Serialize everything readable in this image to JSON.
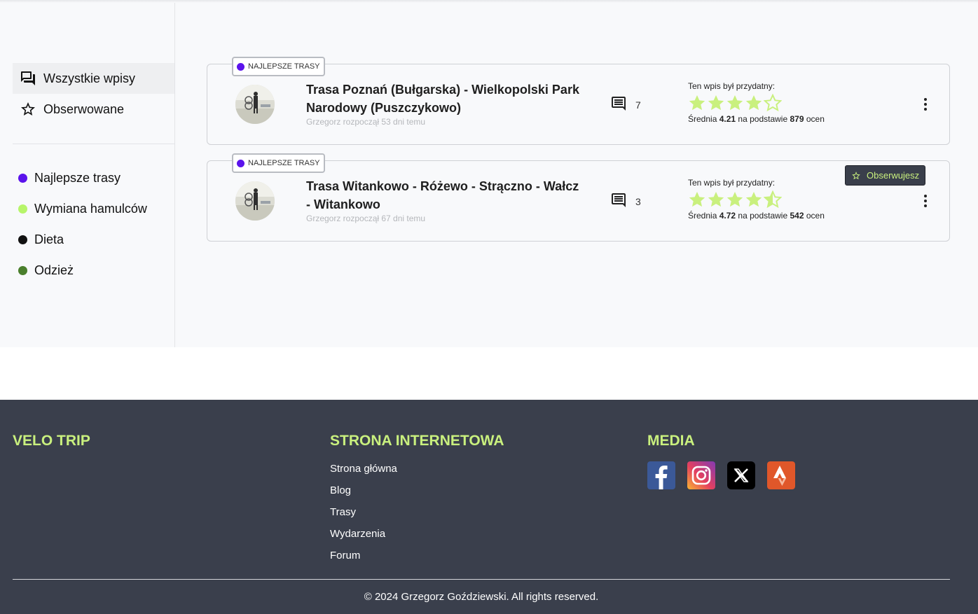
{
  "sidebar": {
    "nav": [
      {
        "label": "Wszystkie wpisy",
        "icon": "forum-icon",
        "active": true
      },
      {
        "label": "Obserwowane",
        "icon": "star-outline-icon",
        "active": false
      }
    ],
    "categories": [
      {
        "label": "Najlepsze trasy",
        "color": "#5b13ec"
      },
      {
        "label": "Wymiana hamulców",
        "color": "#b7f56a"
      },
      {
        "label": "Dieta",
        "color": "#111111"
      },
      {
        "label": "Odzież",
        "color": "#4a7f2c"
      }
    ]
  },
  "posts": [
    {
      "tag": "NAJLEPSZE TRASY",
      "tag_color": "#5b13ec",
      "title": "Trasa Poznań (Bułgarska) - Wielkopolski Park Narodowy (Puszczykowo)",
      "meta": "Grzegorz rozpoczął 53 dni temu",
      "comments": "7",
      "rating_label": "Ten wpis był przydatny:",
      "rating_value": 4.21,
      "avg_prefix": "Średnia",
      "avg": "4.21",
      "avg_middle": "na podstawie",
      "count": "879",
      "avg_suffix": "ocen",
      "following": false
    },
    {
      "tag": "NAJLEPSZE TRASY",
      "tag_color": "#5b13ec",
      "title": "Trasa Witankowo - Różewo - Strączno - Wałcz - Witankowo",
      "meta": "Grzegorz rozpoczął 67 dni temu",
      "comments": "3",
      "rating_label": "Ten wpis był przydatny:",
      "rating_value": 4.72,
      "avg_prefix": "Średnia",
      "avg": "4.72",
      "avg_middle": "na podstawie",
      "count": "542",
      "avg_suffix": "ocen",
      "following": true,
      "follow_label": "Obserwujesz"
    }
  ],
  "colors": {
    "accent": "#c9f07e",
    "star": "#c9f07e",
    "footer_bg": "#3a3f4c"
  },
  "footer": {
    "brand": "VELO TRIP",
    "website_heading": "STRONA INTERNETOWA",
    "links": [
      "Strona główna",
      "Blog",
      "Trasy",
      "Wydarzenia",
      "Forum"
    ],
    "media_heading": "MEDIA",
    "social": [
      "facebook-icon",
      "instagram-icon",
      "x-icon",
      "strava-icon"
    ],
    "copyright": "© 2024 Grzegorz Goździewski. All rights reserved."
  }
}
